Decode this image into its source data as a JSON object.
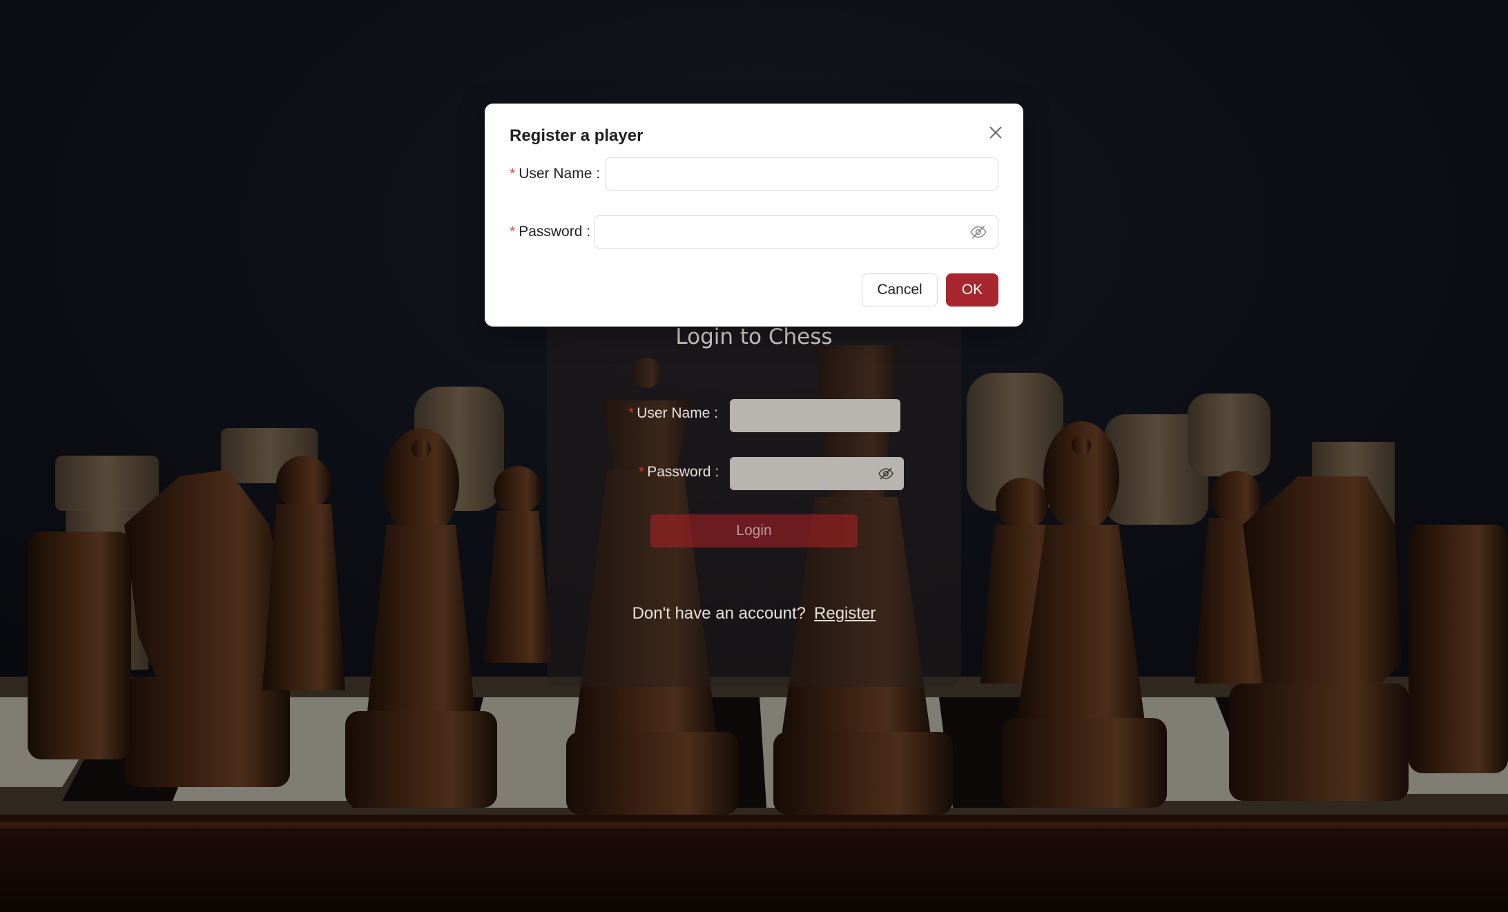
{
  "login": {
    "title": "Login to Chess",
    "username_label": "User Name :",
    "password_label": "Password :",
    "login_button": "Login",
    "footer_text": "Don't have an account?",
    "register_link": "Register"
  },
  "modal": {
    "title": "Register a player",
    "username_label": "User Name :",
    "username_value": "",
    "password_label": "Password :",
    "password_value": "",
    "cancel_label": "Cancel",
    "ok_label": "OK",
    "required_mark": "*"
  },
  "icons": {
    "close": "close-icon",
    "eye_hidden": "eye-invisible-icon"
  },
  "colors": {
    "primary": "#a8262d",
    "required": "#e0434b"
  }
}
